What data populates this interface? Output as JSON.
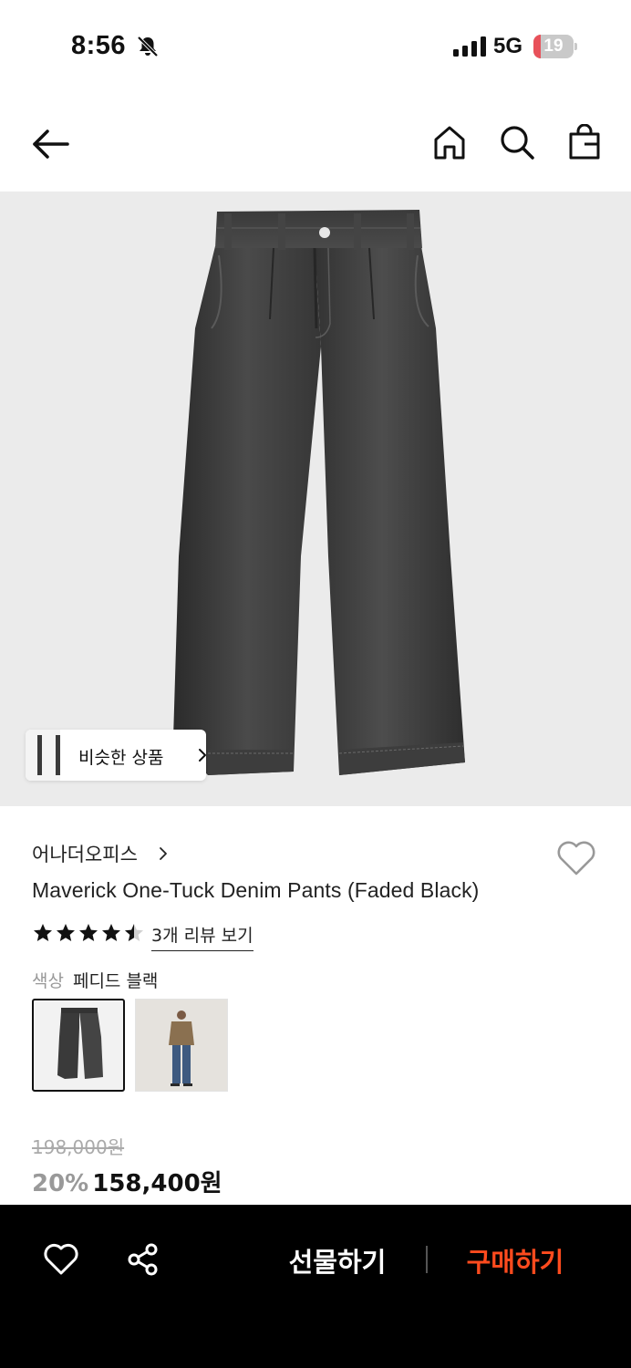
{
  "status_bar": {
    "time": "8:56",
    "network": "5G",
    "battery_level": "19",
    "battery_fraction": 0.19,
    "battery_color": "#e8515a",
    "icons": [
      "bell-slash-icon",
      "signal-icon"
    ]
  },
  "nav": {
    "icons": [
      "back-arrow-icon",
      "home-icon",
      "search-icon",
      "shopping-bag-icon"
    ]
  },
  "similar": {
    "label": "비슷한 상품"
  },
  "product": {
    "brand": "어나더오피스",
    "title": "Maverick One-Tuck Denim Pants (Faded Black)",
    "rating": 4.5,
    "review_link": "3개 리뷰 보기",
    "color_label": "색상",
    "color_value": "페디드 블랙",
    "original_price": "198,000원",
    "discount": "20%",
    "price": "158,400원"
  },
  "bottom_bar": {
    "gift_label": "선물하기",
    "buy_label": "구매하기",
    "buy_color": "#ff4b1e"
  }
}
